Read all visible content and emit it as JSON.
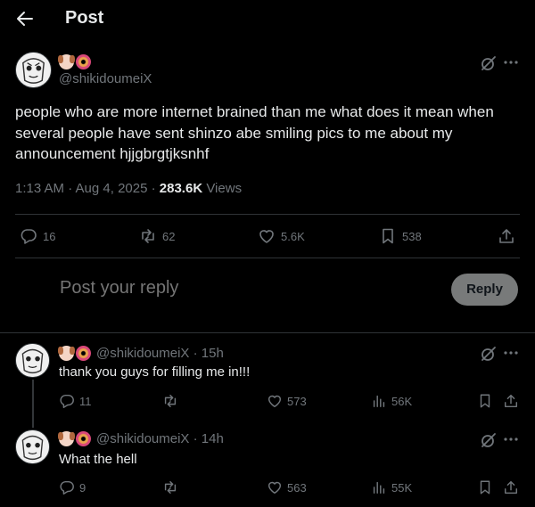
{
  "header": {
    "title": "Post"
  },
  "post": {
    "handle": "@shikidoumeiX",
    "text": "people who are more internet brained than me what does it mean when several people have sent shinzo abe smiling pics to me about my announcement hjjgbrgtjksnhf",
    "timestamp": "1:13 AM · Aug 4, 2025 · ",
    "views_count": "283.6K",
    "views_label": " Views",
    "replies": "16",
    "reposts": "62",
    "likes": "5.6K",
    "bookmarks": "538"
  },
  "composer": {
    "placeholder": "Post your reply",
    "button_label": "Reply"
  },
  "replies": [
    {
      "handle": "@shikidoumeiX",
      "time": " · 15h",
      "text": "thank you guys for filling me in!!!",
      "replies": "11",
      "reposts": "",
      "likes": "573",
      "views": "56K"
    },
    {
      "handle": "@shikidoumeiX",
      "time": " · 14h",
      "text": "What the hell",
      "replies": "9",
      "reposts": "",
      "likes": "563",
      "views": "55K"
    }
  ],
  "colors": {
    "background": "#000000",
    "text": "#e7e9ea",
    "muted": "#71767b",
    "divider": "#2f3336",
    "reply_button": "#787a7a"
  },
  "icons": [
    "back-arrow-icon",
    "grok-icon",
    "more-icon",
    "reply-icon",
    "repost-icon",
    "like-icon",
    "bookmark-icon",
    "share-icon",
    "views-icon",
    "dog-emoji-icon",
    "donut-emoji-icon"
  ]
}
